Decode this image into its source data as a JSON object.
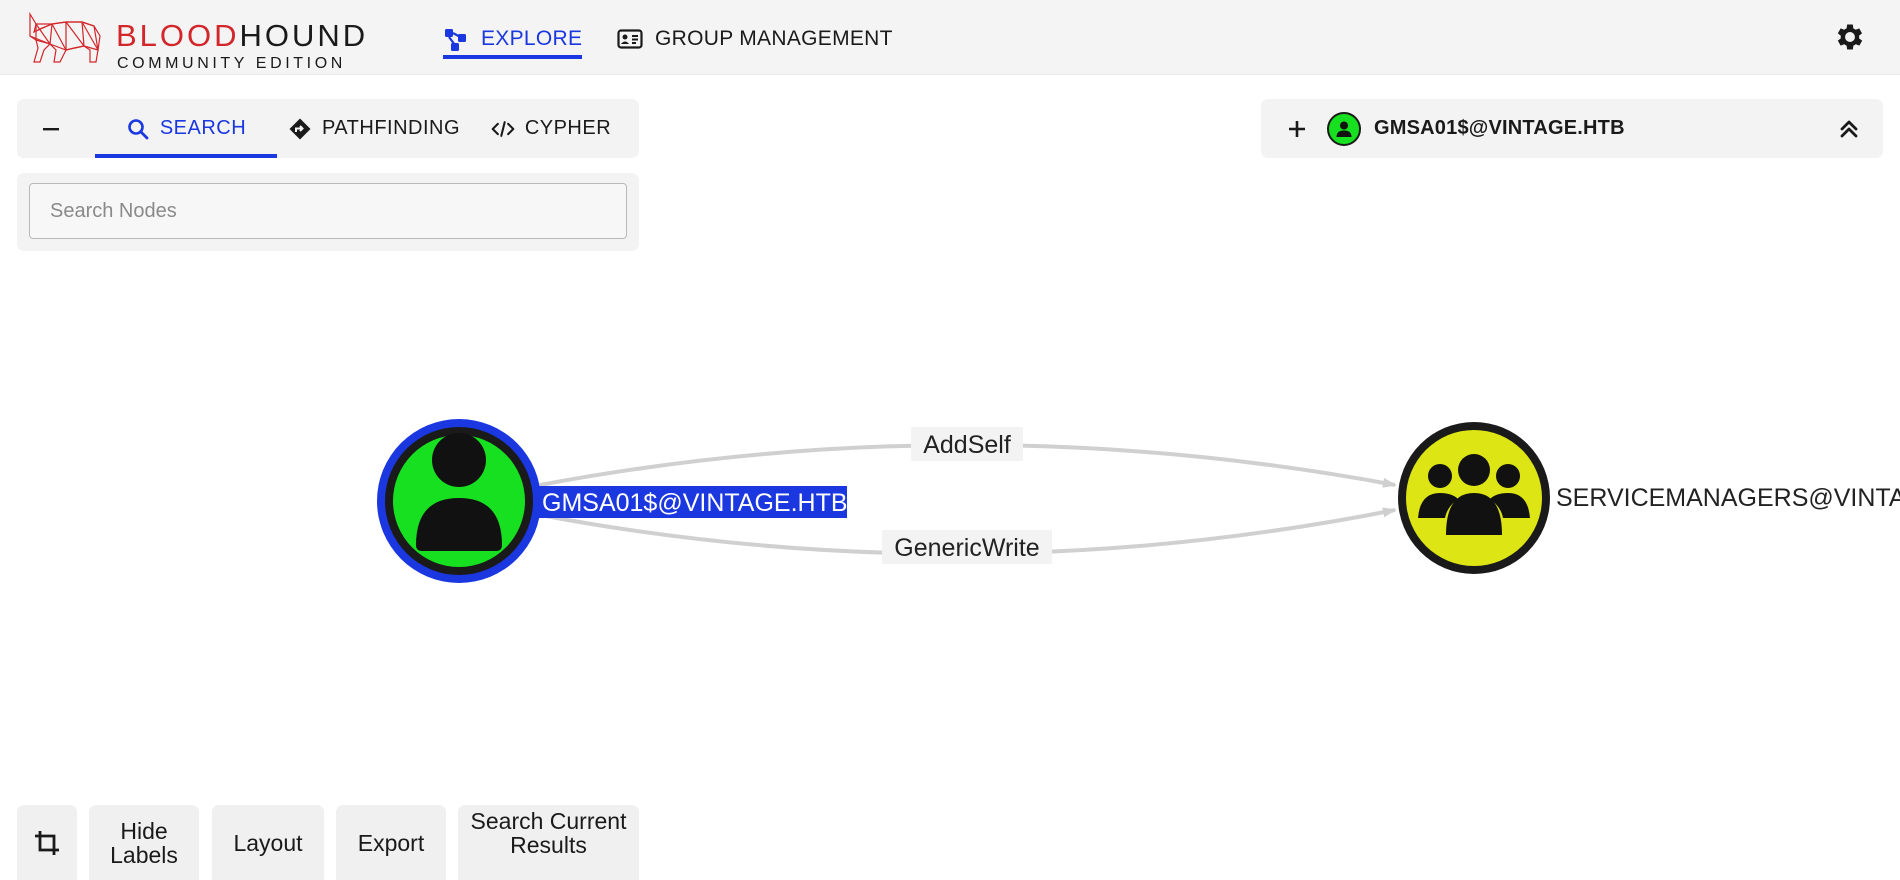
{
  "app": {
    "brand_part1": "BLOOD",
    "brand_part2": "HOUND",
    "subtitle": "COMMUNITY EDITION"
  },
  "nav": {
    "explore": "EXPLORE",
    "group_management": "GROUP MANAGEMENT",
    "active": "explore"
  },
  "search_panel": {
    "tabs": [
      {
        "label": "SEARCH",
        "icon": "search-icon",
        "active": true
      },
      {
        "label": "PATHFINDING",
        "icon": "directions-icon",
        "active": false
      },
      {
        "label": "CYPHER",
        "icon": "code-icon",
        "active": false
      }
    ],
    "placeholder": "Search Nodes"
  },
  "selected": {
    "label": "GMSA01$@VINTAGE.HTB",
    "icon": "user-icon"
  },
  "graph": {
    "nodes": [
      {
        "label": "GMSA01$@VINTAGE.HTB",
        "type": "user",
        "color": "#17e020",
        "selected": true
      },
      {
        "label": "SERVICEMANAGERS@VINTAGE.HTB",
        "type": "group",
        "color": "#dde514",
        "selected": false
      }
    ],
    "edges": [
      {
        "label": "AddSelf"
      },
      {
        "label": "GenericWrite"
      }
    ]
  },
  "toolbar": {
    "hide_labels": "Hide Labels",
    "layout": "Layout",
    "export": "Export",
    "search_results": "Search Current Results"
  },
  "colors": {
    "accent": "#1a37e0",
    "brand_red": "#d3262b",
    "selected_ring": "#1a37e0"
  }
}
